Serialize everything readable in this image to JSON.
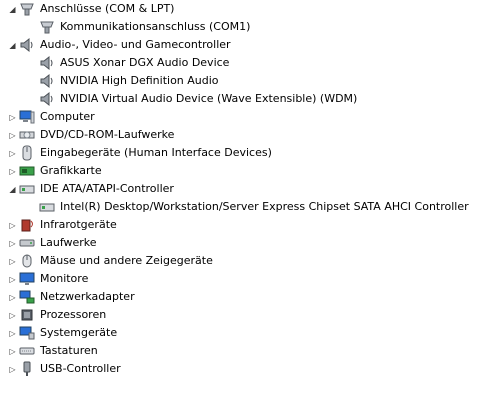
{
  "tree": {
    "items": [
      {
        "label": "Anschlüsse (COM & LPT)",
        "icon": "port-icon",
        "expander": "expanded",
        "depth": 0
      },
      {
        "label": "Kommunikationsanschluss (COM1)",
        "icon": "port-icon",
        "expander": "none",
        "depth": 1
      },
      {
        "label": "Audio-, Video- und Gamecontroller",
        "icon": "speaker-icon",
        "expander": "expanded",
        "depth": 0
      },
      {
        "label": "ASUS Xonar DGX Audio Device",
        "icon": "speaker-icon",
        "expander": "none",
        "depth": 1
      },
      {
        "label": "NVIDIA High Definition Audio",
        "icon": "speaker-icon",
        "expander": "none",
        "depth": 1
      },
      {
        "label": "NVIDIA Virtual Audio Device (Wave Extensible) (WDM)",
        "icon": "speaker-icon",
        "expander": "none",
        "depth": 1
      },
      {
        "label": "Computer",
        "icon": "computer-icon",
        "expander": "collapsed",
        "depth": 0
      },
      {
        "label": "DVD/CD-ROM-Laufwerke",
        "icon": "dvd-drive-icon",
        "expander": "collapsed",
        "depth": 0
      },
      {
        "label": "Eingabegeräte (Human Interface Devices)",
        "icon": "hid-icon",
        "expander": "collapsed",
        "depth": 0
      },
      {
        "label": "Grafikkarte",
        "icon": "display-adapter-icon",
        "expander": "collapsed",
        "depth": 0
      },
      {
        "label": "IDE ATA/ATAPI-Controller",
        "icon": "ide-controller-icon",
        "expander": "expanded",
        "depth": 0
      },
      {
        "label": "Intel(R) Desktop/Workstation/Server Express Chipset SATA AHCI Controller",
        "icon": "ide-controller-icon",
        "expander": "none",
        "depth": 1
      },
      {
        "label": "Infrarotgeräte",
        "icon": "infrared-icon",
        "expander": "collapsed",
        "depth": 0
      },
      {
        "label": "Laufwerke",
        "icon": "disk-drive-icon",
        "expander": "collapsed",
        "depth": 0
      },
      {
        "label": "Mäuse und andere Zeigegeräte",
        "icon": "mouse-icon",
        "expander": "collapsed",
        "depth": 0
      },
      {
        "label": "Monitore",
        "icon": "monitor-icon",
        "expander": "collapsed",
        "depth": 0
      },
      {
        "label": "Netzwerkadapter",
        "icon": "network-adapter-icon",
        "expander": "collapsed",
        "depth": 0
      },
      {
        "label": "Prozessoren",
        "icon": "processor-icon",
        "expander": "collapsed",
        "depth": 0
      },
      {
        "label": "Systemgeräte",
        "icon": "system-devices-icon",
        "expander": "collapsed",
        "depth": 0
      },
      {
        "label": "Tastaturen",
        "icon": "keyboard-icon",
        "expander": "collapsed",
        "depth": 0
      },
      {
        "label": "USB-Controller",
        "icon": "usb-icon",
        "expander": "collapsed",
        "depth": 0
      }
    ]
  }
}
